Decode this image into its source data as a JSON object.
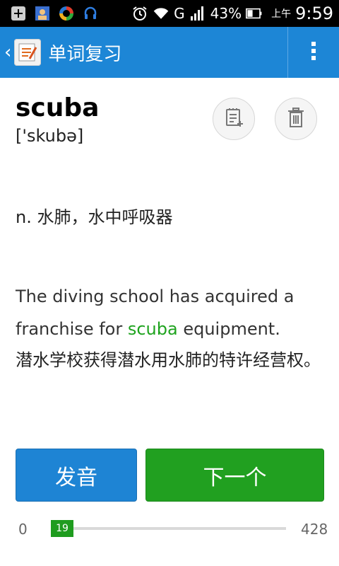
{
  "status_bar": {
    "signal_badge": "G",
    "battery_percent": "43%",
    "time_prefix": "上午",
    "time": "9:59"
  },
  "app_bar": {
    "title": "单词复习"
  },
  "word": {
    "text": "scuba",
    "phonetic": "['skubə]"
  },
  "definition": "n. 水肺，水中呼吸器",
  "example": {
    "before": "The diving school has acquired a franchise for ",
    "highlight": "scuba",
    "after": " equipment.",
    "translation": "潜水学校获得潜水用水肺的特许经营权。",
    "highlight_color": "#1ea31e"
  },
  "buttons": {
    "pronounce_label": "发音",
    "next_label": "下一个"
  },
  "progress": {
    "min": "0",
    "max": "428",
    "current": "19"
  },
  "colors": {
    "app_bar": "#1d86d6",
    "pronounce_button": "#1e84d4",
    "next_button": "#21a020"
  },
  "icons": [
    "notification-plus-icon",
    "contact-icon",
    "sync-app-icon",
    "headset-notification-icon",
    "alarm-icon",
    "wifi-icon",
    "cell-signal-icon",
    "battery-icon",
    "back-chevron-icon",
    "app-logo-icon",
    "overflow-menu-icon",
    "add-to-notebook-icon",
    "trash-icon"
  ]
}
